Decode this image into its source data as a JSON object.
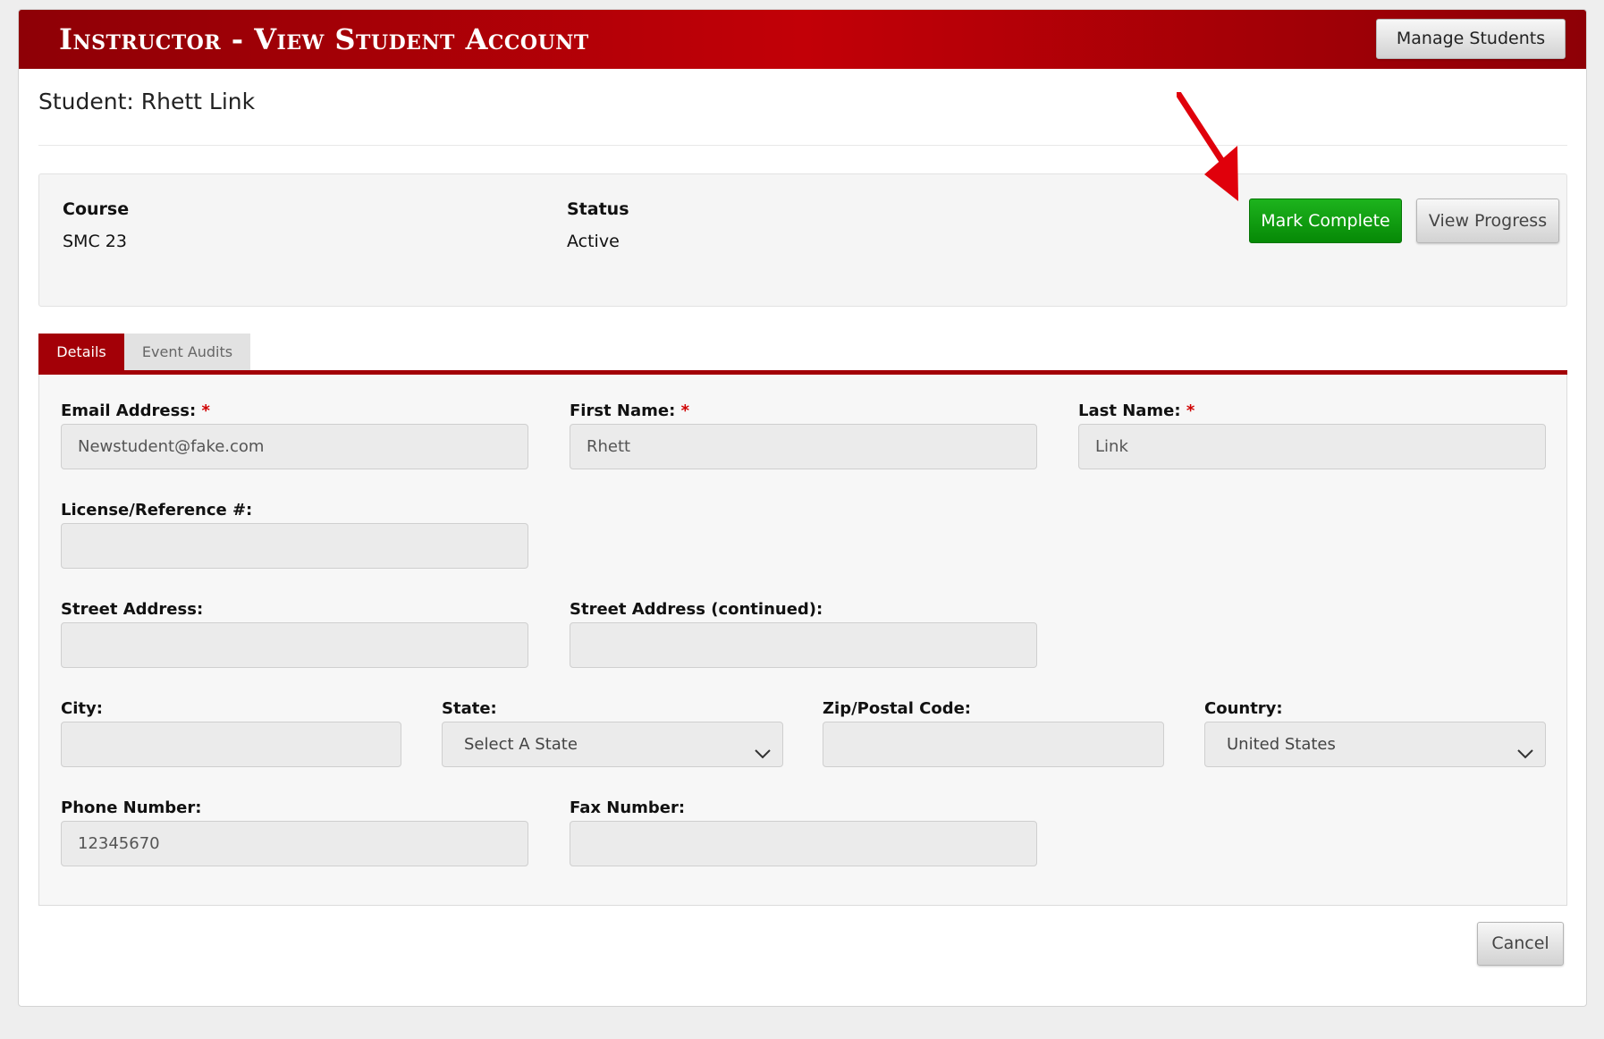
{
  "header": {
    "title": "Instructor - View Student Account",
    "manage_students_label": "Manage Students"
  },
  "student": {
    "heading": "Student: Rhett Link"
  },
  "course_info": {
    "course_label": "Course",
    "course_value": "SMC 23",
    "status_label": "Status",
    "status_value": "Active",
    "mark_complete_label": "Mark Complete",
    "view_progress_label": "View Progress"
  },
  "tabs": [
    {
      "label": "Details",
      "active": true
    },
    {
      "label": "Event Audits",
      "active": false
    }
  ],
  "form": {
    "required_marker": "*",
    "email": {
      "label": "Email Address:",
      "value": "Newstudent@fake.com",
      "required": true
    },
    "first_name": {
      "label": "First Name:",
      "value": "Rhett",
      "required": true
    },
    "last_name": {
      "label": "Last Name:",
      "value": "Link",
      "required": true
    },
    "license": {
      "label": "License/Reference #:",
      "value": ""
    },
    "street": {
      "label": "Street Address:",
      "value": ""
    },
    "street2": {
      "label": "Street Address (continued):",
      "value": ""
    },
    "city": {
      "label": "City:",
      "value": ""
    },
    "state": {
      "label": "State:",
      "selected": "Select A State"
    },
    "zip": {
      "label": "Zip/Postal Code:",
      "value": ""
    },
    "country": {
      "label": "Country:",
      "selected": "United States"
    },
    "phone": {
      "label": "Phone Number:",
      "value": "12345670"
    },
    "fax": {
      "label": "Fax Number:",
      "value": ""
    }
  },
  "footer": {
    "cancel_label": "Cancel"
  },
  "colors": {
    "header_red": "#a30007",
    "mark_complete_green": "#0a9a0a",
    "required_red": "#d00000",
    "annotation_arrow_red": "#e0000b"
  },
  "icons": {
    "annotation": "red-arrow-icon",
    "select_caret": "chevron-down-icon"
  }
}
